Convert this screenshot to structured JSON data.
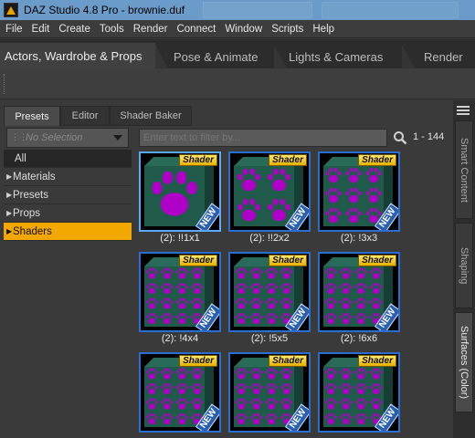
{
  "window": {
    "title": "DAZ Studio 4.8 Pro - brownie.duf"
  },
  "menu": [
    "File",
    "Edit",
    "Create",
    "Tools",
    "Render",
    "Connect",
    "Window",
    "Scripts",
    "Help"
  ],
  "rooms": [
    "Actors, Wardrobe & Props",
    "Pose & Animate",
    "Lights & Cameras",
    "Render"
  ],
  "pane_tabs": [
    "Presets",
    "Editor",
    "Shader Baker"
  ],
  "selector": {
    "text": "No Selection"
  },
  "tree": {
    "all": "All",
    "items": [
      "Materials",
      "Presets",
      "Props",
      "Shaders"
    ],
    "selected": "Shaders"
  },
  "filter": {
    "placeholder": "Enter text to filter by..."
  },
  "count": "1 - 144",
  "tiles": [
    {
      "label": "(2): !!1x1",
      "badge": "Shader",
      "new": "NEW",
      "pattern": "1x1"
    },
    {
      "label": "(2): !!2x2",
      "badge": "Shader",
      "new": "NEW",
      "pattern": "2x2"
    },
    {
      "label": "(2): !3x3",
      "badge": "Shader",
      "new": "NEW",
      "pattern": "3x3"
    },
    {
      "label": "(2): !4x4",
      "badge": "Shader",
      "new": "NEW",
      "pattern": "4x4"
    },
    {
      "label": "(2): !5x5",
      "badge": "Shader",
      "new": "NEW",
      "pattern": "5x5"
    },
    {
      "label": "(2): !6x6",
      "badge": "Shader",
      "new": "NEW",
      "pattern": "6x6"
    },
    {
      "label": "",
      "badge": "Shader",
      "new": "NEW",
      "pattern": "7x7"
    },
    {
      "label": "",
      "badge": "Shader",
      "new": "NEW",
      "pattern": "8x8"
    },
    {
      "label": "",
      "badge": "Shader",
      "new": "NEW",
      "pattern": "9x9"
    }
  ],
  "side_tabs": [
    "Smart Content",
    "Shaping",
    "Surfaces (Color)"
  ],
  "colors": {
    "accent": "#f2a800",
    "tile_border": "#2b6ed0",
    "paw": "#b000c8",
    "cube_green": "#1f5a4a"
  }
}
